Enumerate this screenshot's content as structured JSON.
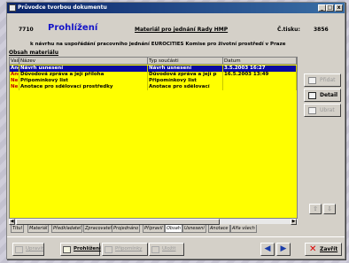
{
  "window": {
    "title": "Průvodce tvorbou dokumentu",
    "buttons": [
      "_",
      "□",
      "x"
    ]
  },
  "header": {
    "number": "7710",
    "mode": "Prohlížení",
    "subject": "Materiál pro jednání Rady HMP",
    "count_label": "Č.tisku:",
    "count_value": "3856",
    "note": "k návrhu na uspořádání pracovního jednání EUROCITIES Komise pro životní prostředí v Praze"
  },
  "section_label": "Obsah materiálu",
  "table": {
    "columns": [
      "Vaš",
      "Název",
      "Typ součásti",
      "Datum"
    ],
    "rows": [
      {
        "cells": [
          "Ano",
          "Návrh usnesení",
          "Návrh usnesení",
          "3.5.2003 16:27"
        ],
        "selected": true
      },
      {
        "cells": [
          "Ano",
          "Důvodová zpráva a její příloha",
          "Důvodová zpráva a její p",
          "16.5.2003 13:49"
        ],
        "selected": false
      },
      {
        "cells": [
          "Ne",
          "Připomínkový list",
          "Připomínkový list",
          ""
        ],
        "selected": false
      },
      {
        "cells": [
          "Ne",
          "Anotace pro sdělovací prostředky",
          "Anotace pro sdělovací",
          ""
        ],
        "selected": false
      }
    ]
  },
  "tabs": [
    "Titul",
    "Materiál",
    "Předkladatel",
    "Zpracovatel",
    "Projednáno",
    "Připravil",
    "Obsah",
    "Usnesení",
    "Anotace",
    "Alfa všech"
  ],
  "active_tab": "Obsah",
  "side_buttons": {
    "add": "Přidat",
    "detail": "Detail",
    "remove": "Ubrat"
  },
  "bottom": {
    "edit": "Upravit",
    "view": "Prohlížení",
    "comments": "Připomínky",
    "save": "Uložit",
    "close": "Zavřít"
  },
  "colors": {
    "grid_bg": "#ffff00",
    "selection": "#0a0aa0",
    "title_bar": "#0a246a",
    "mode_text": "#1414c8"
  }
}
